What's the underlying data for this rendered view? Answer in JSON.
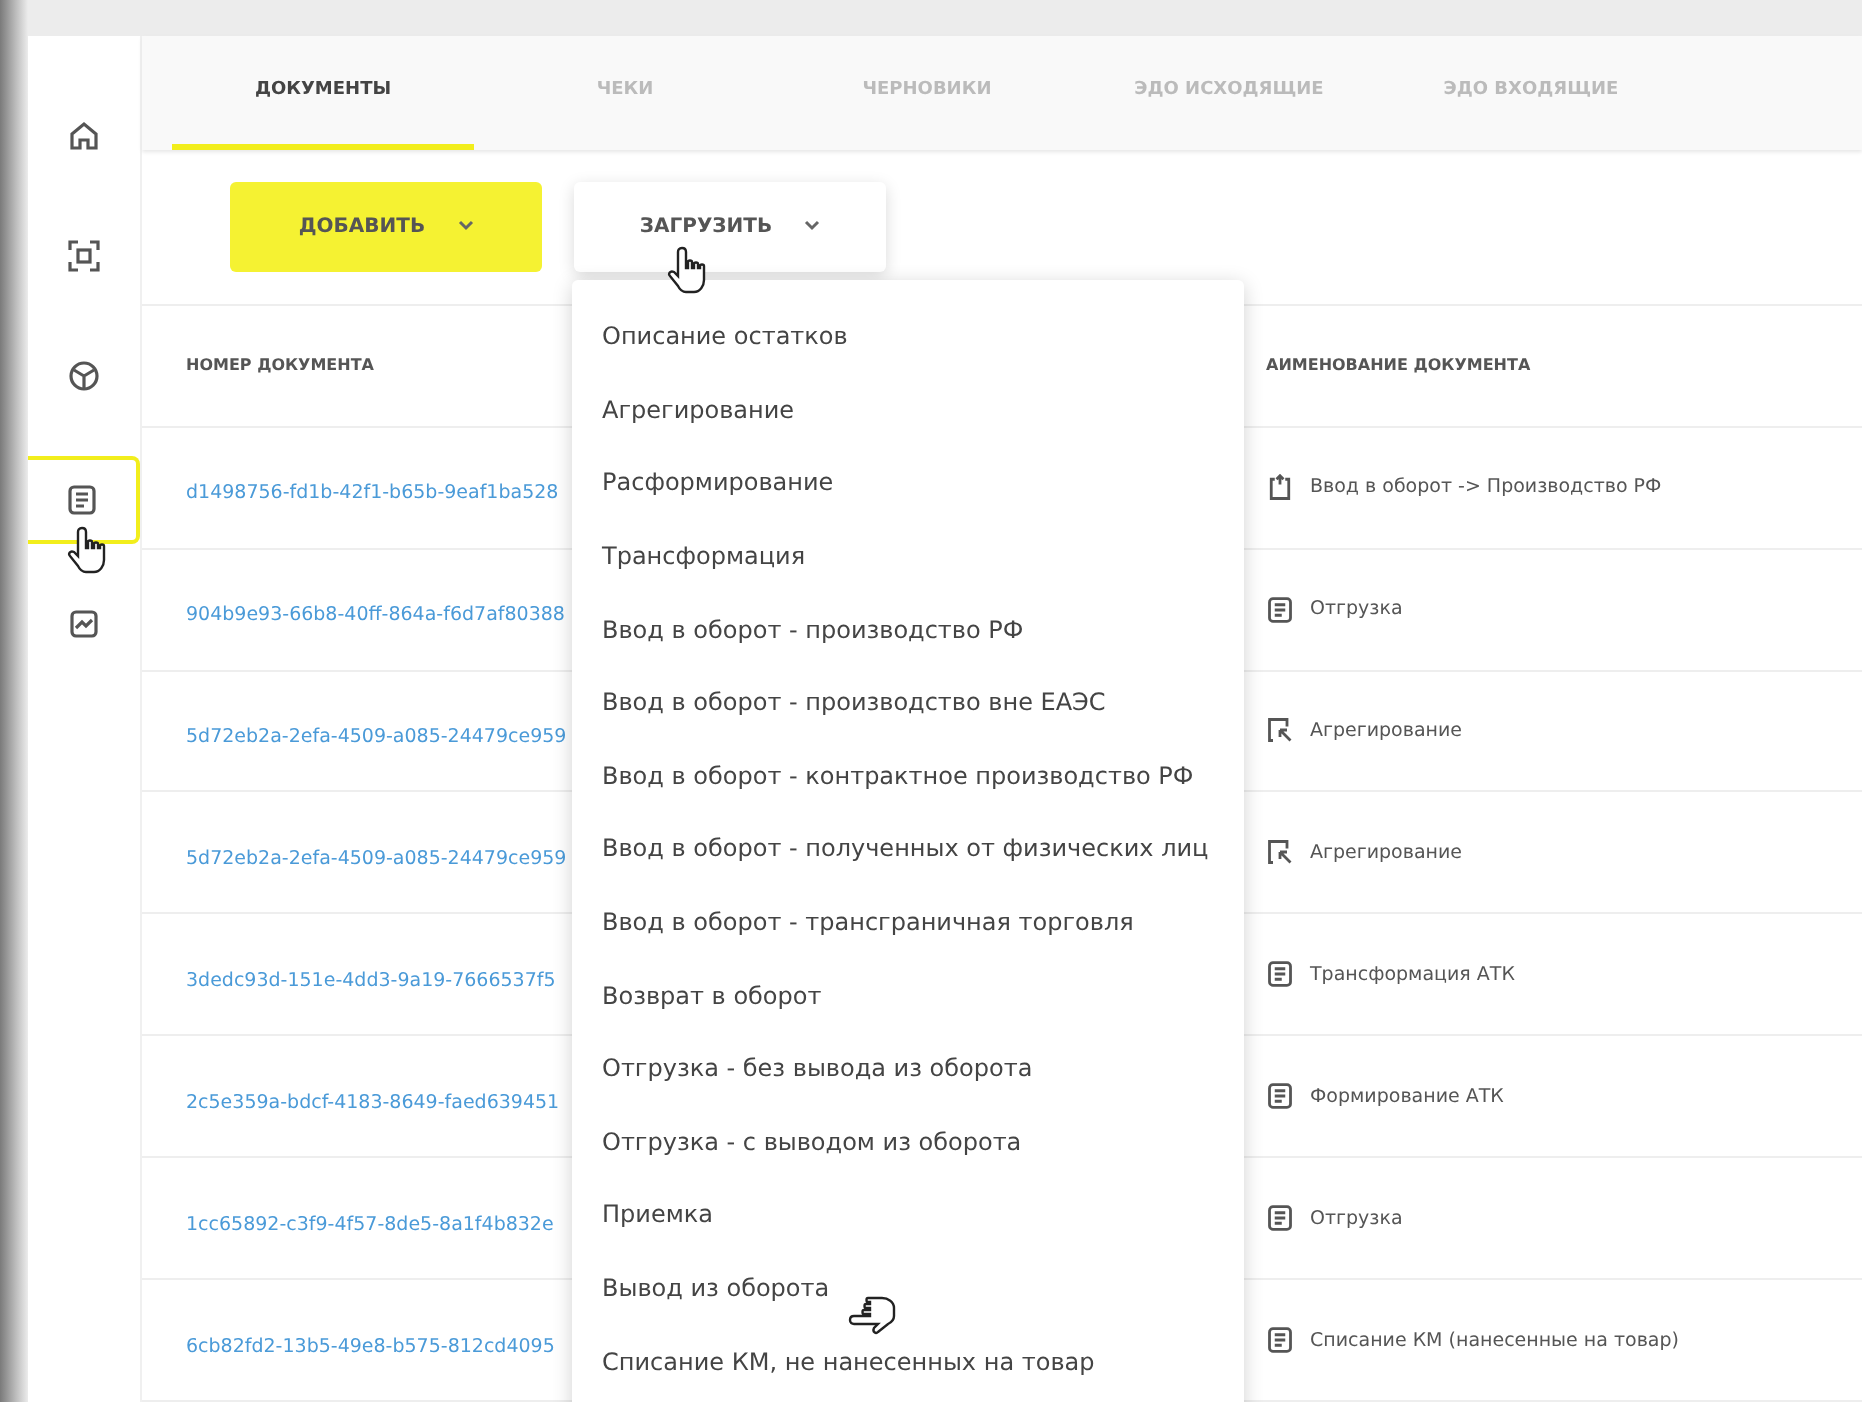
{
  "sidebar": {
    "items": [
      {
        "kind": "home",
        "selected": false
      },
      {
        "kind": "scan",
        "selected": false
      },
      {
        "kind": "box",
        "selected": false
      },
      {
        "kind": "document",
        "selected": true
      },
      {
        "kind": "chart",
        "selected": false
      }
    ]
  },
  "tabs": [
    {
      "label": "ДОКУМЕНТЫ",
      "selected": true
    },
    {
      "label": "ЧЕКИ",
      "selected": false
    },
    {
      "label": "ЧЕРНОВИКИ",
      "selected": false
    },
    {
      "label": "ЭДО ИСХОДЯЩИЕ",
      "selected": false
    },
    {
      "label": "ЭДО ВХОДЯЩИЕ",
      "selected": false
    }
  ],
  "toolbar": {
    "add_button": "ДОБАВИТЬ",
    "upload_button": "ЗАГРУЗИТЬ"
  },
  "table": {
    "columns": [
      "НОМЕР ДОКУМЕНТА",
      "АИМЕНОВАНИЕ ДОКУМЕНТА"
    ],
    "rows": [
      {
        "number": "d1498756-fd1b-42f1-b65b-9eaf1ba528",
        "name": "Ввод в оборот -> Производство РФ",
        "kind": "intro"
      },
      {
        "number": "904b9e93-66b8-40ff-864a-f6d7af80388",
        "name": "Отгрузка",
        "kind": "document"
      },
      {
        "number": "5d72eb2a-2efa-4509-a085-24479ce959",
        "name": "Агрегирование",
        "kind": "aggregate"
      },
      {
        "number": "5d72eb2a-2efa-4509-a085-24479ce959",
        "name": "Агрегирование",
        "kind": "aggregate"
      },
      {
        "number": "3dedc93d-151e-4dd3-9a19-7666537f5",
        "name": "Трансформация АТК",
        "kind": "document"
      },
      {
        "number": "2c5e359a-bdcf-4183-8649-faed639451",
        "name": "Формирование АТК",
        "kind": "document"
      },
      {
        "number": "1cc65892-c3f9-4f57-8de5-8a1f4b832e",
        "name": "Отгрузка",
        "kind": "document"
      },
      {
        "number": "6cb82fd2-13b5-49e8-b575-812cd4095",
        "name": "Списание КМ (нанесенные на товар)",
        "kind": "document"
      }
    ]
  },
  "upload_menu": {
    "items": [
      "Описание остатков",
      "Агрегирование",
      "Расформирование",
      "Трансформация",
      "Ввод в оборот - производство РФ",
      "Ввод в оборот - производство вне ЕАЭС",
      "Ввод в оборот - контрактное производство РФ",
      "Ввод в оборот - полученных от физических лиц",
      "Ввод в оборот - трансграничная торговля",
      "Возврат в оборот",
      "Отгрузка - без вывода из оборота",
      "Отгрузка - с выводом из оборота",
      "Приемка",
      "Вывод из оборота",
      "Списание КМ, не нанесенных на товар"
    ]
  }
}
